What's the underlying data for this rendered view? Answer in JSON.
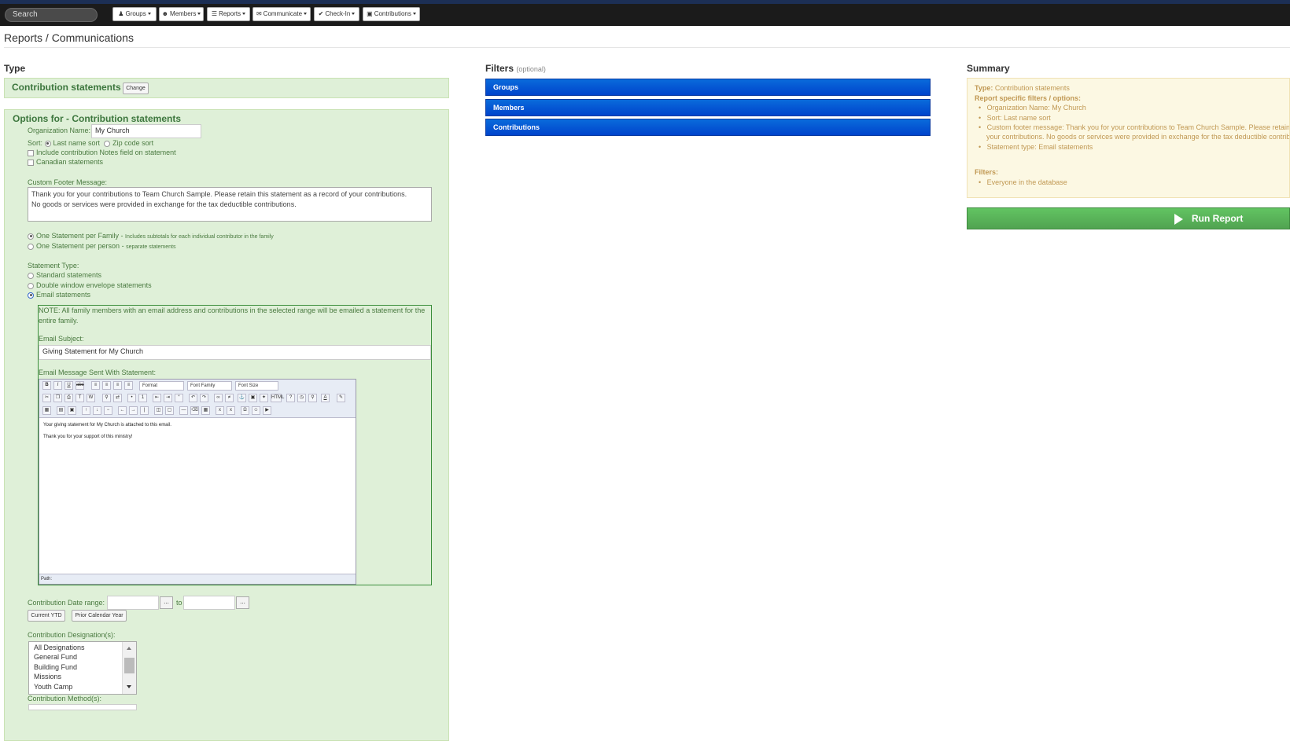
{
  "nav": {
    "search_placeholder": "Search",
    "menus": [
      {
        "label": "Groups",
        "icon": "groups-icon"
      },
      {
        "label": "Members",
        "icon": "person-icon"
      },
      {
        "label": "Reports",
        "icon": "list-icon"
      },
      {
        "label": "Communicate",
        "icon": "envelope-icon"
      },
      {
        "label": "Check-In",
        "icon": "check-icon"
      },
      {
        "label": "Contributions",
        "icon": "card-icon"
      }
    ]
  },
  "breadcrumb": "Reports / Communications",
  "type_section": {
    "heading": "Type",
    "selected": "Contribution statements",
    "change_label": "Change"
  },
  "options": {
    "title": "Options for - Contribution statements",
    "org_name_label": "Organization Name:",
    "org_name_value": "My Church",
    "sort_label": "Sort:",
    "sort_last": "Last name sort",
    "sort_zip": "Zip code sort",
    "include_notes": "Include contribution Notes field on statement",
    "canadian": "Canadian statements",
    "footer_label": "Custom Footer Message:",
    "footer_line1": "Thank you for your contributions to Team Church Sample.  Please retain this statement as a record of your contributions.",
    "footer_line2": "No goods or services were provided in exchange for the tax deductible contributions.",
    "per_family": "One Statement per Family - ",
    "per_family_note": "Includes subtotals for each individual contributor in the family",
    "per_person": "One Statement per person - ",
    "per_person_note": "separate statements",
    "stmt_type_label": "Statement Type:",
    "stmt_standard": "Standard statements",
    "stmt_double": "Double window envelope statements",
    "stmt_email": "Email statements",
    "note_text": "NOTE: All family members with an email address and contributions in the selected range will be emailed a statement for the entire family.",
    "email_subject_label": "Email Subject:",
    "email_subject_value": "Giving Statement for My Church",
    "email_msg_label": "Email Message Sent With Statement:",
    "editor_format": "Format",
    "editor_font_family": "Font Family",
    "editor_font_size": "Font Size",
    "editor_line1": "Your giving statement for My Church is attached to this email.",
    "editor_line2": "Thank you for your support of this ministry!",
    "editor_path": "Path:",
    "date_range_label": "Contribution Date range:",
    "date_to": "to",
    "date_btn": "...",
    "current_ytd": "Current YTD",
    "prior_year": "Prior Calendar Year",
    "designations_label": "Contribution Designation(s):",
    "designations": [
      "All Designations",
      "General Fund",
      "Building Fund",
      "Missions",
      "Youth Camp"
    ],
    "method_label": "Contribution Method(s):"
  },
  "filters": {
    "heading": "Filters",
    "optional": "(optional)",
    "items": [
      "Groups",
      "Members",
      "Contributions"
    ]
  },
  "summary": {
    "heading": "Summary",
    "type_label": "Type:",
    "type_value": " Contribution statements",
    "specific_label": "Report specific filters / options:",
    "items": [
      "Organization Name: My Church",
      "Sort: Last name sort",
      "Custom footer message: Thank you for your contributions to Team Church Sample.  Please retain this statement as a record of",
      "your contributions. No goods or services were provided in exchange for the tax deductible contributions.",
      "Statement type: Email statements"
    ],
    "filters_label": "Filters:",
    "filters_items": [
      "Everyone in the database"
    ]
  },
  "run_report_label": "Run Report",
  "colors": {
    "navbar": "#1b1b1b",
    "filter_blue": "#0044cc",
    "success_green": "#51a351",
    "panel_green": "#dff0d8",
    "summary_yellow": "#fcf8e3"
  }
}
